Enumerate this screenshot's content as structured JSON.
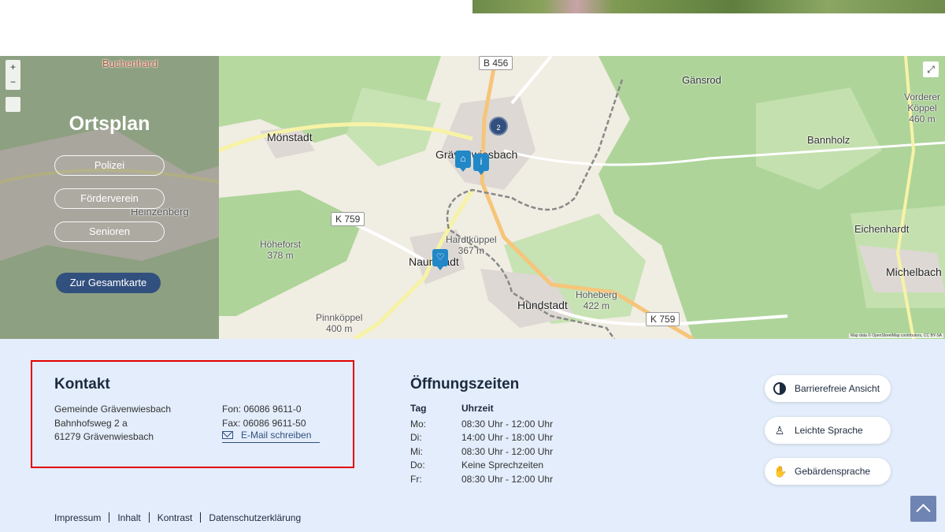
{
  "map": {
    "title": "Ortsplan",
    "links": [
      "Polizei",
      "Förderverein",
      "Senioren"
    ],
    "cta_label": "Zur Gesamtkarte",
    "zoom_in": "+",
    "zoom_out": "−",
    "cluster_count": "2",
    "attribution": "Map data © OpenStreetMap contributors, CC BY-SA",
    "places": {
      "moenstadt": "Mönstadt",
      "graevenwiesbach": "Grävenwiesbach",
      "naunstadt": "Naunstadt",
      "hundstadt": "Hundstadt",
      "michelbach": "Michelbach",
      "eichenhardt": "Eichenhardt",
      "gaensrod": "Gänsrod",
      "bannholz": "Bannholz",
      "heinzenberg": "Heinzenberg",
      "buchenhard": "Buchenhard"
    },
    "peaks": {
      "hoheforst": [
        "Höheforst",
        "378 m"
      ],
      "hardtkueppel": [
        "Hardtküppel",
        "367 m"
      ],
      "hoheberg": [
        "Hoheberg",
        "422 m"
      ],
      "pinnkoeppel": [
        "Pinnköppel",
        "400 m"
      ],
      "vorderer": [
        "Vorderer",
        "Köppel",
        "460 m"
      ]
    },
    "roads": {
      "b456": "B 456",
      "k759a": "K 759",
      "k759b": "K 759"
    }
  },
  "kontakt": {
    "title": "Kontakt",
    "address": [
      "Gemeinde Grävenwiesbach",
      "Bahnhofsweg 2 a",
      "61279 Grävenwiesbach"
    ],
    "phone": "Fon: 06086 9611-0",
    "fax": "Fax: 06086 9611-50",
    "email_label": "E-Mail schreiben"
  },
  "oeffnungszeiten": {
    "title": "Öffnungszeiten",
    "head_day": "Tag",
    "head_time": "Uhrzeit",
    "rows": [
      {
        "day": "Mo:",
        "time": "08:30 Uhr - 12:00 Uhr"
      },
      {
        "day": "Di:",
        "time": "14:00 Uhr - 18:00 Uhr"
      },
      {
        "day": "Mi:",
        "time": "08:30 Uhr - 12:00 Uhr"
      },
      {
        "day": "Do:",
        "time": "Keine Sprechzeiten"
      },
      {
        "day": "Fr:",
        "time": "08:30 Uhr - 12:00 Uhr"
      }
    ]
  },
  "accessibility": {
    "contrast": "Barrierefreie Ansicht",
    "easy_language": "Leichte Sprache",
    "sign_language": "Gebärdensprache"
  },
  "footer_links": [
    "Impressum",
    "Inhalt",
    "Kontrast",
    "Datenschutzerklärung"
  ],
  "colors": {
    "accent": "#32507e",
    "footer_bg": "#e3edfb",
    "highlight": "#e20000",
    "marker": "#2287c7"
  }
}
